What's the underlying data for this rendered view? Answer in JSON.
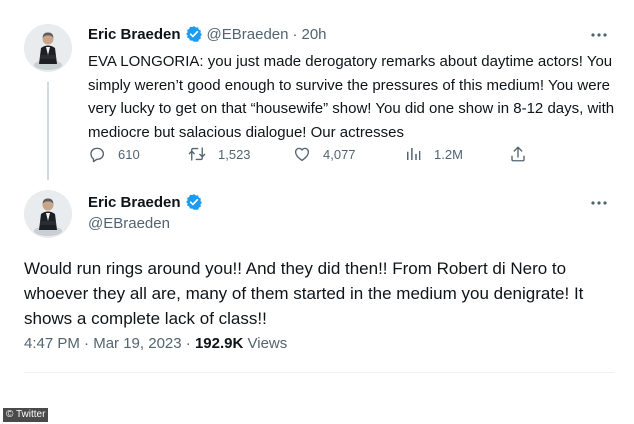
{
  "tweet1": {
    "author_name": "Eric Braeden",
    "handle": "@EBraeden",
    "separator": "·",
    "time_ago": "20h",
    "text": "EVA LONGORIA: you just made derogatory remarks about daytime actors! You simply weren’t good enough to survive the pressures of this medium! You were very lucky to get on that “housewife” show! You did one show in 8-12 days, with mediocre but  salacious dialogue! Our actresses",
    "stats": {
      "replies": "610",
      "retweets": "1,523",
      "likes": "4,077",
      "views": "1.2M"
    }
  },
  "tweet2": {
    "author_name": "Eric Braeden",
    "handle": "@EBraeden",
    "text": "Would run rings around you!! And they did then!! From Robert di Nero to whoever they all are, many of them started in the medium you denigrate! It shows a complete lack of class!!",
    "time": "4:47 PM",
    "separator1": "·",
    "date": "Mar 19, 2023",
    "separator2": "·",
    "views_count": "192.9K",
    "views_label": "Views"
  },
  "credit": "© Twitter",
  "colors": {
    "verified_blue": "#1d9bf0",
    "secondary_text": "#536471",
    "primary_text": "#0f1419"
  },
  "icons": [
    "verified-badge-icon",
    "more-options-icon",
    "reply-icon",
    "retweet-icon",
    "like-icon",
    "views-icon",
    "share-icon"
  ]
}
